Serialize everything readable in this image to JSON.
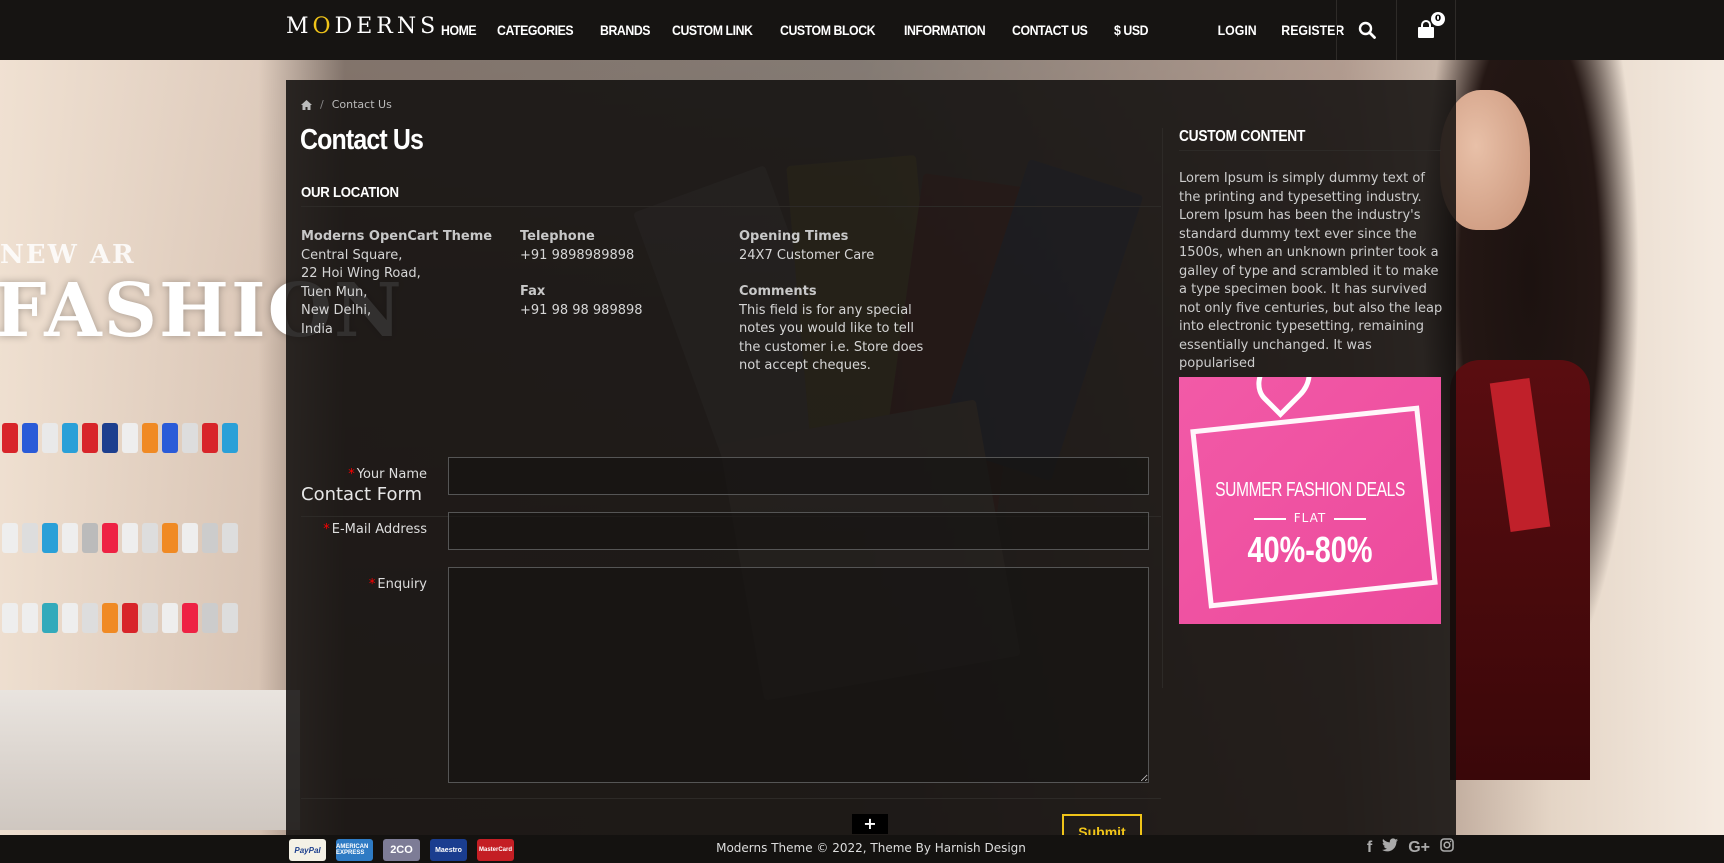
{
  "header": {
    "logo_prefix": "M",
    "logo_o": "O",
    "logo_suffix": "DERNS",
    "nav": [
      "HOME",
      "CATEGORIES",
      "BRANDS",
      "CUSTOM LINK",
      "CUSTOM BLOCK",
      "INFORMATION",
      "CONTACT US",
      "$ USD"
    ],
    "login": "LOGIN",
    "register": "REGISTER",
    "cart_count": "0"
  },
  "background": {
    "new_arrivals": "NEW AR",
    "fashion": "FASHION"
  },
  "breadcrumb": {
    "current": "Contact Us",
    "separator": "/"
  },
  "page_title": "Contact Us",
  "location": {
    "section_title": "OUR LOCATION",
    "store_name": "Moderns OpenCart Theme",
    "address": [
      "Central Square,",
      "22 Hoi Wing Road,",
      "Tuen Mun,",
      "New Delhi,",
      "India"
    ],
    "telephone_label": "Telephone",
    "telephone": "+91 9898989898",
    "fax_label": "Fax",
    "fax": "+91 98 98 989898",
    "opening_label": "Opening Times",
    "opening": "24X7 Customer Care",
    "comments_label": "Comments",
    "comments": "This field is for any special notes you would like to tell the customer i.e. Store does not accept cheques."
  },
  "contact_form": {
    "title": "Contact Form",
    "name_label": "Your Name",
    "email_label": "E-Mail Address",
    "enquiry_label": "Enquiry",
    "required_mark": "*",
    "submit": "Submit"
  },
  "sidebar": {
    "title": "CUSTOM CONTENT",
    "text": "Lorem Ipsum is simply dummy text of the printing and typesetting industry. Lorem Ipsum has been the industry's standard dummy text ever since the 1500s, when an unknown printer took a galley of type and scrambled it to make a type specimen book. It has survived not only five centuries, but also the leap into electronic typesetting, remaining essentially unchanged. It was popularised",
    "promo_line1": "SUMMER FASHION DEALS",
    "promo_line2": "FLAT",
    "promo_line3": "40%-80%"
  },
  "footer": {
    "payments": [
      "PayPal",
      "AMERICAN EXPRESS",
      "2CO",
      "Maestro",
      "MasterCard"
    ],
    "copyright": "Moderns Theme © 2022, Theme By Harnish Design",
    "social": [
      "f",
      "t",
      "G+",
      "ig"
    ],
    "scroll_top": "+"
  },
  "colors": {
    "accent": "#f0c419",
    "required": "#ff0000",
    "promo_bg": "#ec4a9c"
  }
}
